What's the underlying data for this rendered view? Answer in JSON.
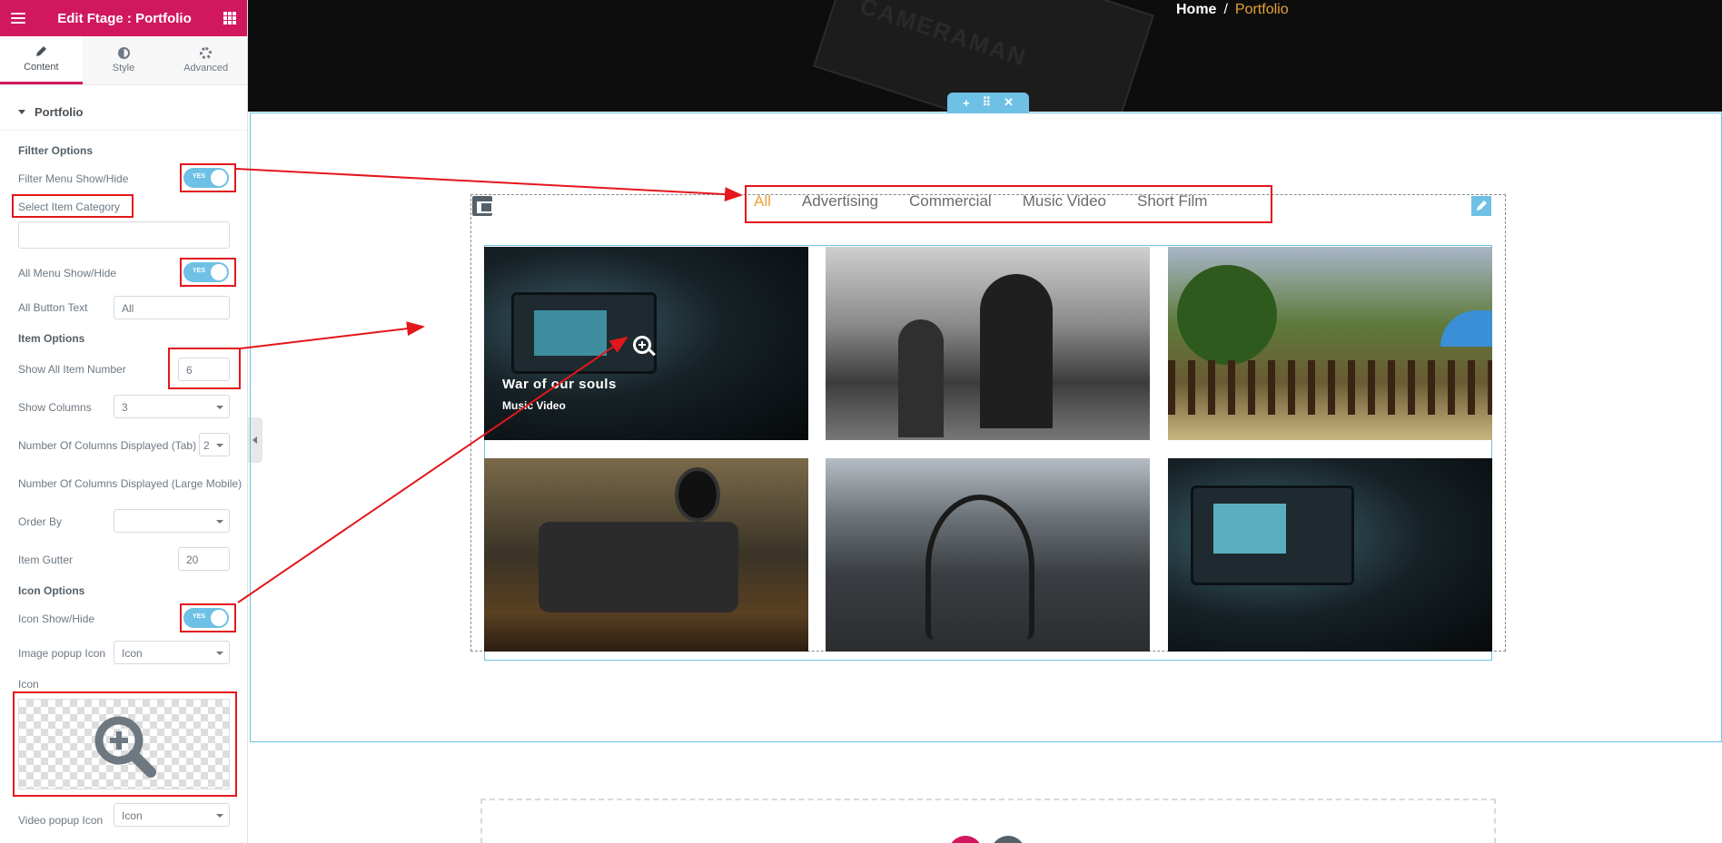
{
  "panel": {
    "title": "Edit Ftage : Portfolio",
    "tabs": [
      {
        "label": "Content",
        "icon": "pencil-icon"
      },
      {
        "label": "Style",
        "icon": "half-circle-icon"
      },
      {
        "label": "Advanced",
        "icon": "gear-icon"
      }
    ],
    "section_title": "Portfolio",
    "filter_options_heading": "Filtter Options",
    "filter_menu_label": "Filter Menu Show/Hide",
    "select_category_label": "Select Item Category",
    "all_menu_label": "All Menu Show/Hide",
    "all_button_text_label": "All Button Text",
    "all_button_text_value": "All",
    "item_options_heading": "Item Options",
    "show_all_item_number_label": "Show All Item Number",
    "show_all_item_number_value": "6",
    "show_columns_label": "Show Columns",
    "show_columns_value": "3",
    "columns_tab_label": "Number Of Columns Displayed (Tab)",
    "columns_tab_value": "2",
    "columns_large_mobile_label": "Number Of Columns Displayed (Large Mobile)",
    "order_by_label": "Order By",
    "order_by_value": "",
    "item_gutter_label": "Item Gutter",
    "item_gutter_value": "20",
    "icon_options_heading": "Icon Options",
    "icon_show_label": "Icon Show/Hide",
    "image_popup_label": "Image popup Icon",
    "image_popup_value": "Icon",
    "icon_label": "Icon",
    "video_popup_label": "Video popup Icon",
    "video_popup_value": "Icon",
    "toggle_yes": "YES"
  },
  "hero": {
    "breadcrumb_home": "Home",
    "breadcrumb_sep": "/",
    "breadcrumb_current": "Portfolio",
    "background_text": "CAMERAMAN"
  },
  "section_handle": {
    "add": "+",
    "move": "⠿",
    "close": "✕"
  },
  "filters": [
    "All",
    "Advertising",
    "Commercial",
    "Music Video",
    "Short Film"
  ],
  "portfolio": {
    "first_item_title": "War of our souls",
    "first_item_category": "Music Video"
  },
  "colors": {
    "brand": "#d1185f",
    "accent": "#6ec1e4",
    "active_filter": "#e7a33a",
    "annotation": "#e3171c"
  }
}
